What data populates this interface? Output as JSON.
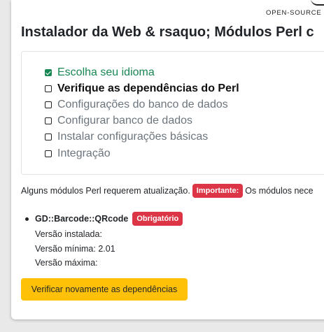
{
  "logo": {
    "text": "OPEN-SOURCE I"
  },
  "page": {
    "title": "Instalador da Web & rsaquo; Módulos Perl c"
  },
  "steps": [
    {
      "label": "Escolha seu idioma",
      "state": "done"
    },
    {
      "label": "Verifique as dependências do Perl",
      "state": "current"
    },
    {
      "label": "Configurações do banco de dados",
      "state": "todo"
    },
    {
      "label": "Configurar banco de dados",
      "state": "todo"
    },
    {
      "label": "Instalar configurações básicas",
      "state": "todo"
    },
    {
      "label": "Integração",
      "state": "todo"
    }
  ],
  "notice": {
    "text": "Alguns módulos Perl requerem atualização.",
    "badge": "Importante:",
    "after": "Os módulos nece"
  },
  "module": {
    "name": "GD::Barcode::QRcode",
    "badge": "Obrigatório",
    "installed_label": "Versão instalada:",
    "minimum_label": "Versão mínima: 2.01",
    "maximum_label": "Versão máxima:"
  },
  "actions": {
    "recheck_label": "Verificar novamente as dependências"
  },
  "colors": {
    "done": "#198754",
    "danger": "#dc3545",
    "warning": "#ffc107"
  }
}
